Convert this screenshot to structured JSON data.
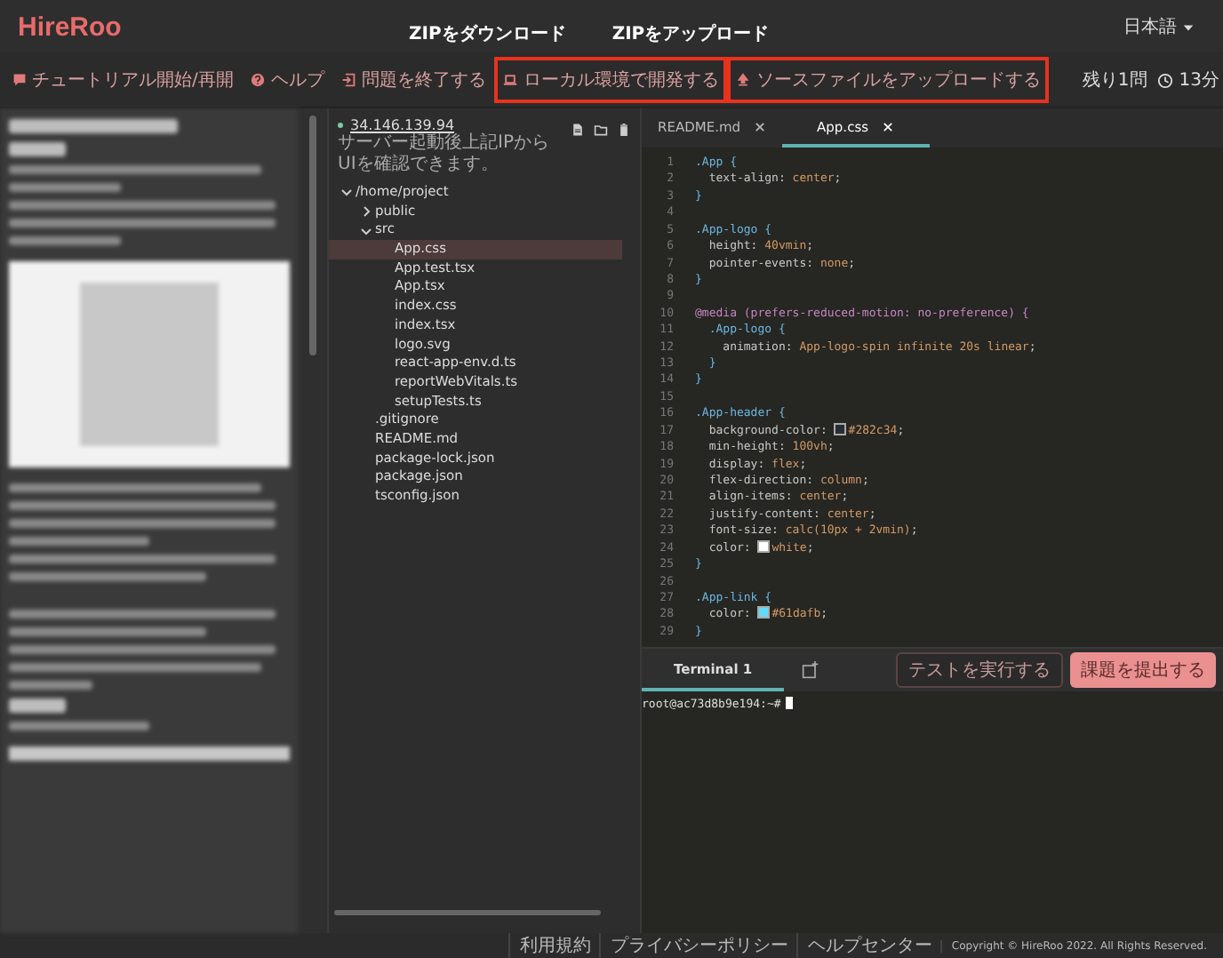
{
  "header": {
    "logo": "HireRoo",
    "language": "日本語",
    "annotations": [
      "ZIPをダウンロード",
      "ZIPをアップロード"
    ]
  },
  "toolbar": {
    "items": [
      {
        "label": "チュートリアル開始/再開",
        "highlighted": false
      },
      {
        "label": "ヘルプ",
        "highlighted": false
      },
      {
        "label": "問題を終了する",
        "highlighted": false
      },
      {
        "label": "ローカル環境で開発する",
        "highlighted": true
      },
      {
        "label": "ソースファイルをアップロードする",
        "highlighted": true
      }
    ],
    "remaining": "残り1問",
    "time": "13分"
  },
  "files": {
    "ip": "34.146.139.94",
    "note": "サーバー起動後上記IPからUIを確認できます。",
    "tree": [
      {
        "name": "/home/project",
        "expanded": true,
        "selected": false,
        "children": [
          {
            "name": "public",
            "expanded": false,
            "selected": false
          },
          {
            "name": "src",
            "expanded": true,
            "selected": false,
            "children": [
              {
                "name": "App.css",
                "selected": true
              },
              {
                "name": "App.test.tsx",
                "selected": false
              },
              {
                "name": "App.tsx",
                "selected": false
              },
              {
                "name": "index.css",
                "selected": false
              },
              {
                "name": "index.tsx",
                "selected": false
              },
              {
                "name": "logo.svg",
                "selected": false
              },
              {
                "name": "react-app-env.d.ts",
                "selected": false
              },
              {
                "name": "reportWebVitals.ts",
                "selected": false
              },
              {
                "name": "setupTests.ts",
                "selected": false
              }
            ]
          },
          {
            "name": ".gitignore",
            "selected": false
          },
          {
            "name": "README.md",
            "selected": false
          },
          {
            "name": "package-lock.json",
            "selected": false
          },
          {
            "name": "package.json",
            "selected": false
          },
          {
            "name": "tsconfig.json",
            "selected": false
          }
        ]
      }
    ]
  },
  "editor": {
    "tabs": [
      {
        "label": "README.md",
        "selected": false
      },
      {
        "label": "App.css",
        "selected": true
      }
    ],
    "lines": [
      {
        "n": "1",
        "code": ".App {"
      },
      {
        "n": "2",
        "code": "  text-align: center;"
      },
      {
        "n": "3",
        "code": "}"
      },
      {
        "n": "4"
      },
      {
        "n": "5",
        "code": ".App-logo {"
      },
      {
        "n": "6",
        "code": "  height: 40vmin;"
      },
      {
        "n": "7",
        "code": "  pointer-events: none;"
      },
      {
        "n": "8",
        "code": "}"
      },
      {
        "n": "9"
      },
      {
        "n": "10",
        "code": "@media (prefers-reduced-motion: no-preference) {"
      },
      {
        "n": "11",
        "code": "  .App-logo {"
      },
      {
        "n": "12",
        "code": "    animation: App-logo-spin infinite 20s linear;"
      },
      {
        "n": "13",
        "code": "  }"
      },
      {
        "n": "14",
        "code": "}"
      },
      {
        "n": "15"
      },
      {
        "n": "16",
        "code": ".App-header {"
      },
      {
        "n": "17",
        "code": "  background-color: #282c34;",
        "color": "#282c34"
      },
      {
        "n": "18",
        "code": "  min-height: 100vh;"
      },
      {
        "n": "19",
        "code": "  display: flex;"
      },
      {
        "n": "20",
        "code": "  flex-direction: column;"
      },
      {
        "n": "21",
        "code": "  align-items: center;"
      },
      {
        "n": "22",
        "code": "  justify-content: center;"
      },
      {
        "n": "23",
        "code": "  font-size: calc(10px + 2vmin);"
      },
      {
        "n": "24",
        "code": "  color: white;",
        "color": "#ffffff"
      },
      {
        "n": "25",
        "code": "}"
      },
      {
        "n": "26"
      },
      {
        "n": "27",
        "code": ".App-link {"
      },
      {
        "n": "28",
        "code": "  color: #61dafb;",
        "color": "#61dafb"
      },
      {
        "n": "29",
        "code": "}"
      }
    ]
  },
  "terminal": {
    "tab": "Terminal 1",
    "run_tests": "テストを実行する",
    "submit": "課題を提出する",
    "prompt": "root@ac73d8b9e194:~#"
  },
  "footer": [
    "利用規約",
    "プライバシーポリシー",
    "ヘルプセンター",
    "Copyright © HireRoo 2022. All Rights Reserved."
  ]
}
